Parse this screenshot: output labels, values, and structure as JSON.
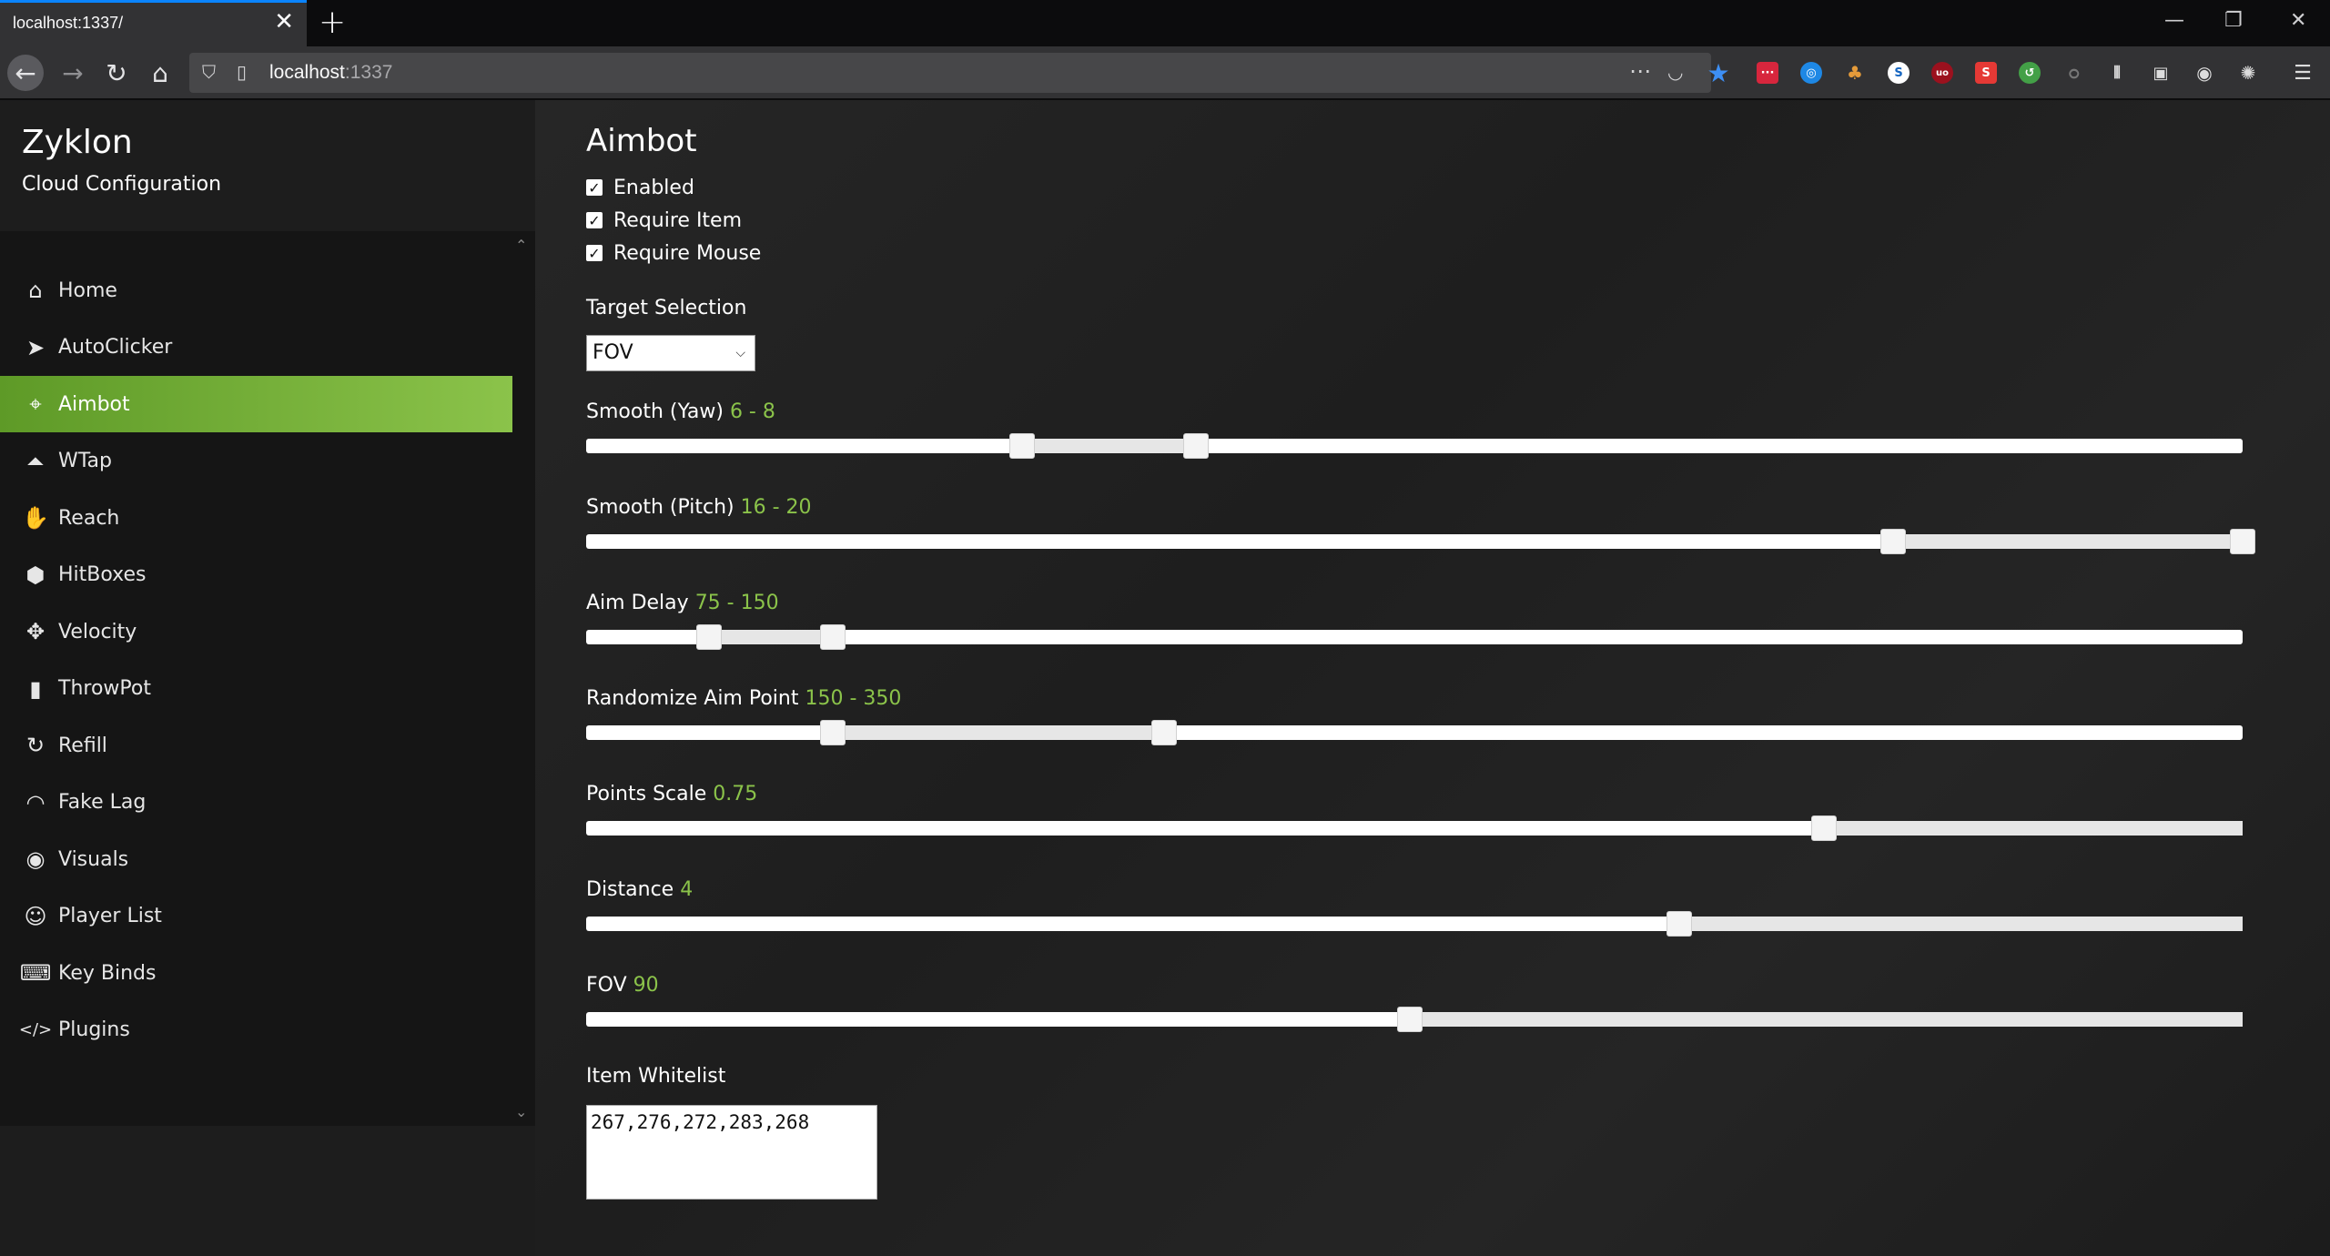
{
  "browser": {
    "tab_title": "localhost:1337/",
    "tab_close": "✕",
    "new_tab": "+",
    "url_host": "localhost",
    "url_port": ":1337",
    "window_controls": [
      "—",
      "❐",
      "✕"
    ]
  },
  "sidebar": {
    "brand": "Zyklon",
    "subtitle": "Cloud Configuration",
    "active_color": "#8bc34a",
    "items": [
      {
        "label": "Home",
        "icon": "home-icon",
        "glyph": "⌂"
      },
      {
        "label": "AutoClicker",
        "icon": "pointer-icon",
        "glyph": "➤"
      },
      {
        "label": "Aimbot",
        "icon": "crosshair-icon",
        "glyph": "⌖"
      },
      {
        "label": "WTap",
        "icon": "double-chevron-up-icon",
        "glyph": "⏶"
      },
      {
        "label": "Reach",
        "icon": "hand-icon",
        "glyph": "✋"
      },
      {
        "label": "HitBoxes",
        "icon": "cube-icon",
        "glyph": "⬢"
      },
      {
        "label": "Velocity",
        "icon": "move-arrows-icon",
        "glyph": "✥"
      },
      {
        "label": "ThrowPot",
        "icon": "potion-icon",
        "glyph": "▮"
      },
      {
        "label": "Refill",
        "icon": "refresh-icon",
        "glyph": "↻"
      },
      {
        "label": "Fake Lag",
        "icon": "wifi-icon",
        "glyph": "◠"
      },
      {
        "label": "Visuals",
        "icon": "eye-icon",
        "glyph": "◉"
      },
      {
        "label": "Player List",
        "icon": "user-icon",
        "glyph": "☺"
      },
      {
        "label": "Key Binds",
        "icon": "keyboard-icon",
        "glyph": "⌨"
      },
      {
        "label": "Plugins",
        "icon": "code-icon",
        "glyph": "</>"
      }
    ]
  },
  "main": {
    "title": "Aimbot",
    "checkboxes": [
      {
        "label": "Enabled",
        "checked": true
      },
      {
        "label": "Require Item",
        "checked": true
      },
      {
        "label": "Require Mouse",
        "checked": true
      }
    ],
    "target_selection": {
      "label": "Target Selection",
      "value": "FOV"
    },
    "sliders": [
      {
        "label": "Smooth (Yaw)",
        "value_text": "6 - 8",
        "type": "range",
        "fractions": [
          0.263,
          0.368
        ]
      },
      {
        "label": "Smooth (Pitch)",
        "value_text": "16 - 20",
        "type": "range",
        "fractions": [
          0.789,
          1.0
        ]
      },
      {
        "label": "Aim Delay",
        "value_text": "75 - 150",
        "type": "range",
        "fractions": [
          0.074,
          0.149
        ]
      },
      {
        "label": "Randomize Aim Point",
        "value_text": "150 - 350",
        "type": "range",
        "fractions": [
          0.149,
          0.349
        ]
      },
      {
        "label": "Points Scale",
        "value_text": "0.75",
        "type": "single",
        "fractions": [
          0.747
        ]
      },
      {
        "label": "Distance",
        "value_text": "4",
        "type": "single",
        "fractions": [
          0.66
        ]
      },
      {
        "label": "FOV",
        "value_text": "90",
        "type": "single",
        "fractions": [
          0.497
        ]
      }
    ],
    "whitelist": {
      "label": "Item Whitelist",
      "value": "267,276,272,283,268"
    }
  }
}
